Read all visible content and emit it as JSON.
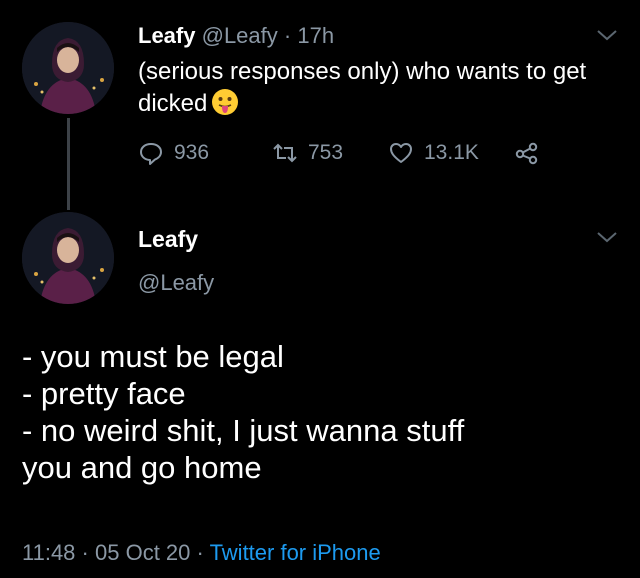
{
  "tweet1": {
    "display_name": "Leafy",
    "handle": "@Leafy",
    "separator": "·",
    "time": "17h",
    "text": "(serious responses only) who wants to get dicked",
    "emoji": "face-with-tongue",
    "actions": {
      "replies": "936",
      "retweets": "753",
      "likes": "13.1K"
    }
  },
  "tweet2": {
    "display_name": "Leafy",
    "handle": "@Leafy",
    "lines": [
      "- you must be legal",
      "- pretty face",
      "- no weird shit, I just wanna stuff",
      "you and go home"
    ],
    "time": "11:48",
    "separator1": "·",
    "date": "05 Oct 20",
    "separator2": "·",
    "source": "Twitter for iPhone"
  },
  "icons": {
    "reply": "reply-icon",
    "retweet": "retweet-icon",
    "like": "heart-icon",
    "share": "share-icon",
    "menu": "chevron-down-icon"
  },
  "colors": {
    "background": "#000000",
    "muted": "#8b98a5",
    "link": "#1d9bf0",
    "thread_line": "#3d4248"
  }
}
